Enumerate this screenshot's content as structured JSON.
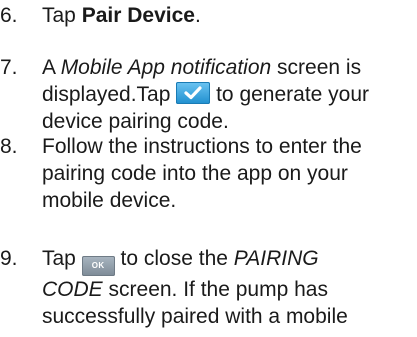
{
  "steps": [
    {
      "number": "6.",
      "text_before": "Tap ",
      "bold_text": "Pair Device",
      "text_after": "."
    },
    {
      "number": "7.",
      "line1_prefix": "A ",
      "line1_italic": "Mobile App notification",
      "line1_suffix": " screen is",
      "line2_prefix": "displayed.Tap ",
      "line2_suffix": " to generate your",
      "line3": "device pairing code.",
      "button_icon": "checkmark-icon"
    },
    {
      "number": "8.",
      "line1": "Follow the instructions to enter the",
      "line2": "pairing code into the app on your",
      "line3": "mobile device."
    },
    {
      "number": "9.",
      "line1_prefix": "Tap ",
      "ok_label": "OK",
      "line1_mid": " to close the ",
      "line1_italic": "PAIRING",
      "line2_italic": "CODE",
      "line2_suffix": " screen. If the pump has",
      "line3": "successfully paired with a mobile"
    }
  ],
  "colors": {
    "text": "#1a1a1a",
    "check_button": "#2e9ad8",
    "ok_button": "#8b98a4"
  }
}
